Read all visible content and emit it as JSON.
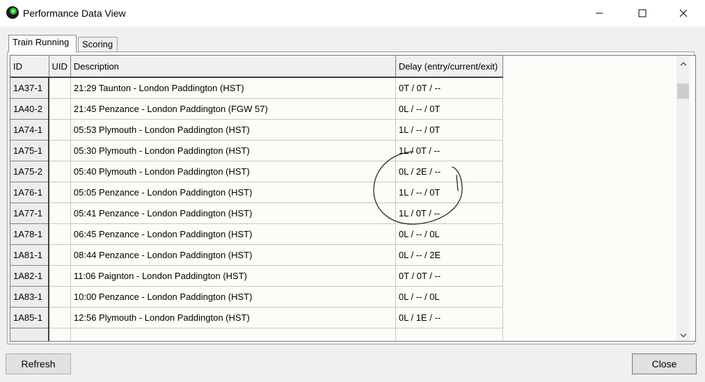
{
  "window": {
    "title": "Performance Data View",
    "icon": "train-app-icon",
    "controls": [
      "minimize-icon",
      "maximize-icon",
      "close-icon"
    ]
  },
  "tabs": [
    {
      "label": "Train Running",
      "active": true
    },
    {
      "label": "Scoring",
      "active": false
    }
  ],
  "table": {
    "columns": [
      "ID",
      "UID",
      "Description",
      "Delay (entry/current/exit)"
    ],
    "rows": [
      {
        "id": "1A37-1",
        "uid": "",
        "description": "21:29 Taunton - London Paddington (HST)",
        "delay": "0T / 0T / --"
      },
      {
        "id": "1A40-2",
        "uid": "",
        "description": "21:45 Penzance - London Paddington (FGW 57)",
        "delay": "0L / -- / 0T"
      },
      {
        "id": "1A74-1",
        "uid": "",
        "description": "05:53 Plymouth - London Paddington (HST)",
        "delay": "1L / -- / 0T"
      },
      {
        "id": "1A75-1",
        "uid": "",
        "description": "05:30 Plymouth - London Paddington (HST)",
        "delay": "1L / 0T / --"
      },
      {
        "id": "1A75-2",
        "uid": "",
        "description": "05:40 Plymouth - London Paddington (HST)",
        "delay": "0L / 2E / --"
      },
      {
        "id": "1A76-1",
        "uid": "",
        "description": "05:05 Penzance - London Paddington (HST)",
        "delay": "1L / -- / 0T"
      },
      {
        "id": "1A77-1",
        "uid": "",
        "description": "05:41 Penzance - London Paddington (HST)",
        "delay": "1L / 0T / --"
      },
      {
        "id": "1A78-1",
        "uid": "",
        "description": "06:45 Penzance - London Paddington (HST)",
        "delay": "0L / -- / 0L"
      },
      {
        "id": "1A81-1",
        "uid": "",
        "description": "08:44 Penzance - London Paddington (HST)",
        "delay": "0L / -- / 2E"
      },
      {
        "id": "1A82-1",
        "uid": "",
        "description": "11:06 Paignton - London Paddington (HST)",
        "delay": "0T / 0T / --"
      },
      {
        "id": "1A83-1",
        "uid": "",
        "description": "10:00 Penzance - London Paddington (HST)",
        "delay": "0L / -- / 0L"
      },
      {
        "id": "1A85-1",
        "uid": "",
        "description": "12:56 Plymouth - London Paddington (HST)",
        "delay": "0L / 1E / --"
      },
      {
        "id": "",
        "uid": "",
        "description": "",
        "delay": ""
      }
    ]
  },
  "scrollbar": {
    "up": "chevron-up-icon",
    "down": "chevron-down-icon"
  },
  "buttons": {
    "refresh": "Refresh",
    "close": "Close"
  },
  "colors": {
    "title_bg": "#ffffff",
    "window_bg": "#f0f0f0",
    "grid_bg": "#fdfcf8",
    "icon_green": "#2fbf2f"
  }
}
